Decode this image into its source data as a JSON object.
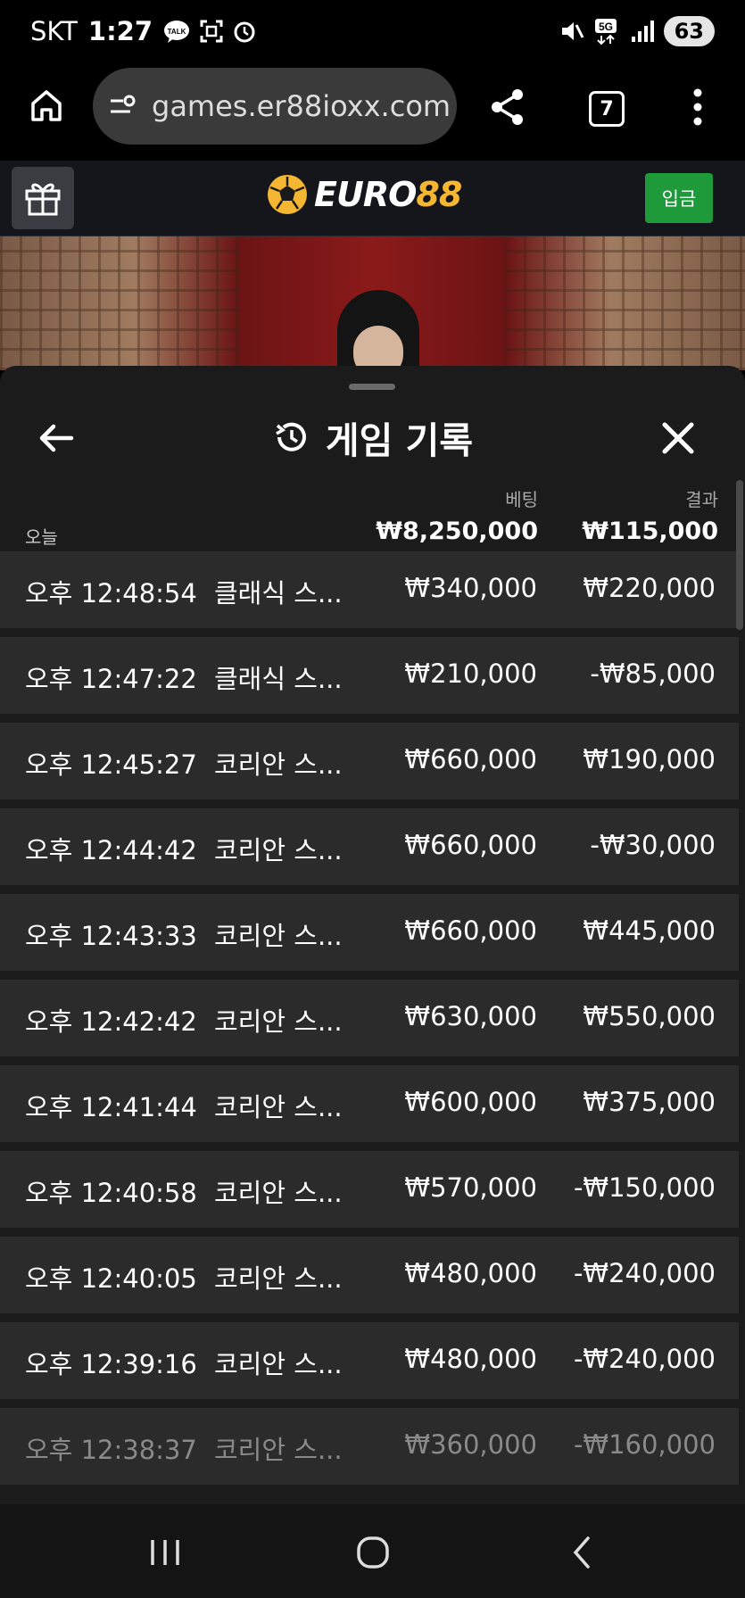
{
  "status_bar": {
    "carrier": "SKT",
    "time": "1:27",
    "battery": "63"
  },
  "browser": {
    "url": "games.er88ioxx.com",
    "tab_count": "7"
  },
  "site": {
    "logo_euro": "EURO",
    "logo_num": "88",
    "deposit_label": "입금"
  },
  "panel": {
    "title": "게임 기록",
    "bet_label": "베팅",
    "result_label": "결과",
    "day_label": "오늘",
    "total_bet": "₩8,250,000",
    "total_result": "₩115,000"
  },
  "rows": [
    {
      "time": "오후 12:48:54",
      "game": "클래식 스...",
      "bet": "₩340,000",
      "result": "₩220,000"
    },
    {
      "time": "오후 12:47:22",
      "game": "클래식 스...",
      "bet": "₩210,000",
      "result": "-₩85,000"
    },
    {
      "time": "오후 12:45:27",
      "game": "코리안 스...",
      "bet": "₩660,000",
      "result": "₩190,000"
    },
    {
      "time": "오후 12:44:42",
      "game": "코리안 스...",
      "bet": "₩660,000",
      "result": "-₩30,000"
    },
    {
      "time": "오후 12:43:33",
      "game": "코리안 스...",
      "bet": "₩660,000",
      "result": "₩445,000"
    },
    {
      "time": "오후 12:42:42",
      "game": "코리안 스...",
      "bet": "₩630,000",
      "result": "₩550,000"
    },
    {
      "time": "오후 12:41:44",
      "game": "코리안 스...",
      "bet": "₩600,000",
      "result": "₩375,000"
    },
    {
      "time": "오후 12:40:58",
      "game": "코리안 스...",
      "bet": "₩570,000",
      "result": "-₩150,000"
    },
    {
      "time": "오후 12:40:05",
      "game": "코리안 스...",
      "bet": "₩480,000",
      "result": "-₩240,000"
    },
    {
      "time": "오후 12:39:16",
      "game": "코리안 스...",
      "bet": "₩480,000",
      "result": "-₩240,000"
    },
    {
      "time": "오후 12:38:37",
      "game": "코리안 스...",
      "bet": "₩360,000",
      "result": "-₩160,000"
    }
  ],
  "icons": {
    "home": "home-icon",
    "site_settings": "site-settings-icon",
    "share": "share-icon",
    "menu": "more-vert-icon",
    "gift": "gift-icon",
    "history": "history-icon",
    "back": "arrow-left-icon",
    "close": "close-icon"
  },
  "colors": {
    "accent_green": "#1f9a3a",
    "logo_gold": "#f5b731",
    "panel_bg": "#1b1b1c",
    "row_bg": "#2b2b2c"
  }
}
